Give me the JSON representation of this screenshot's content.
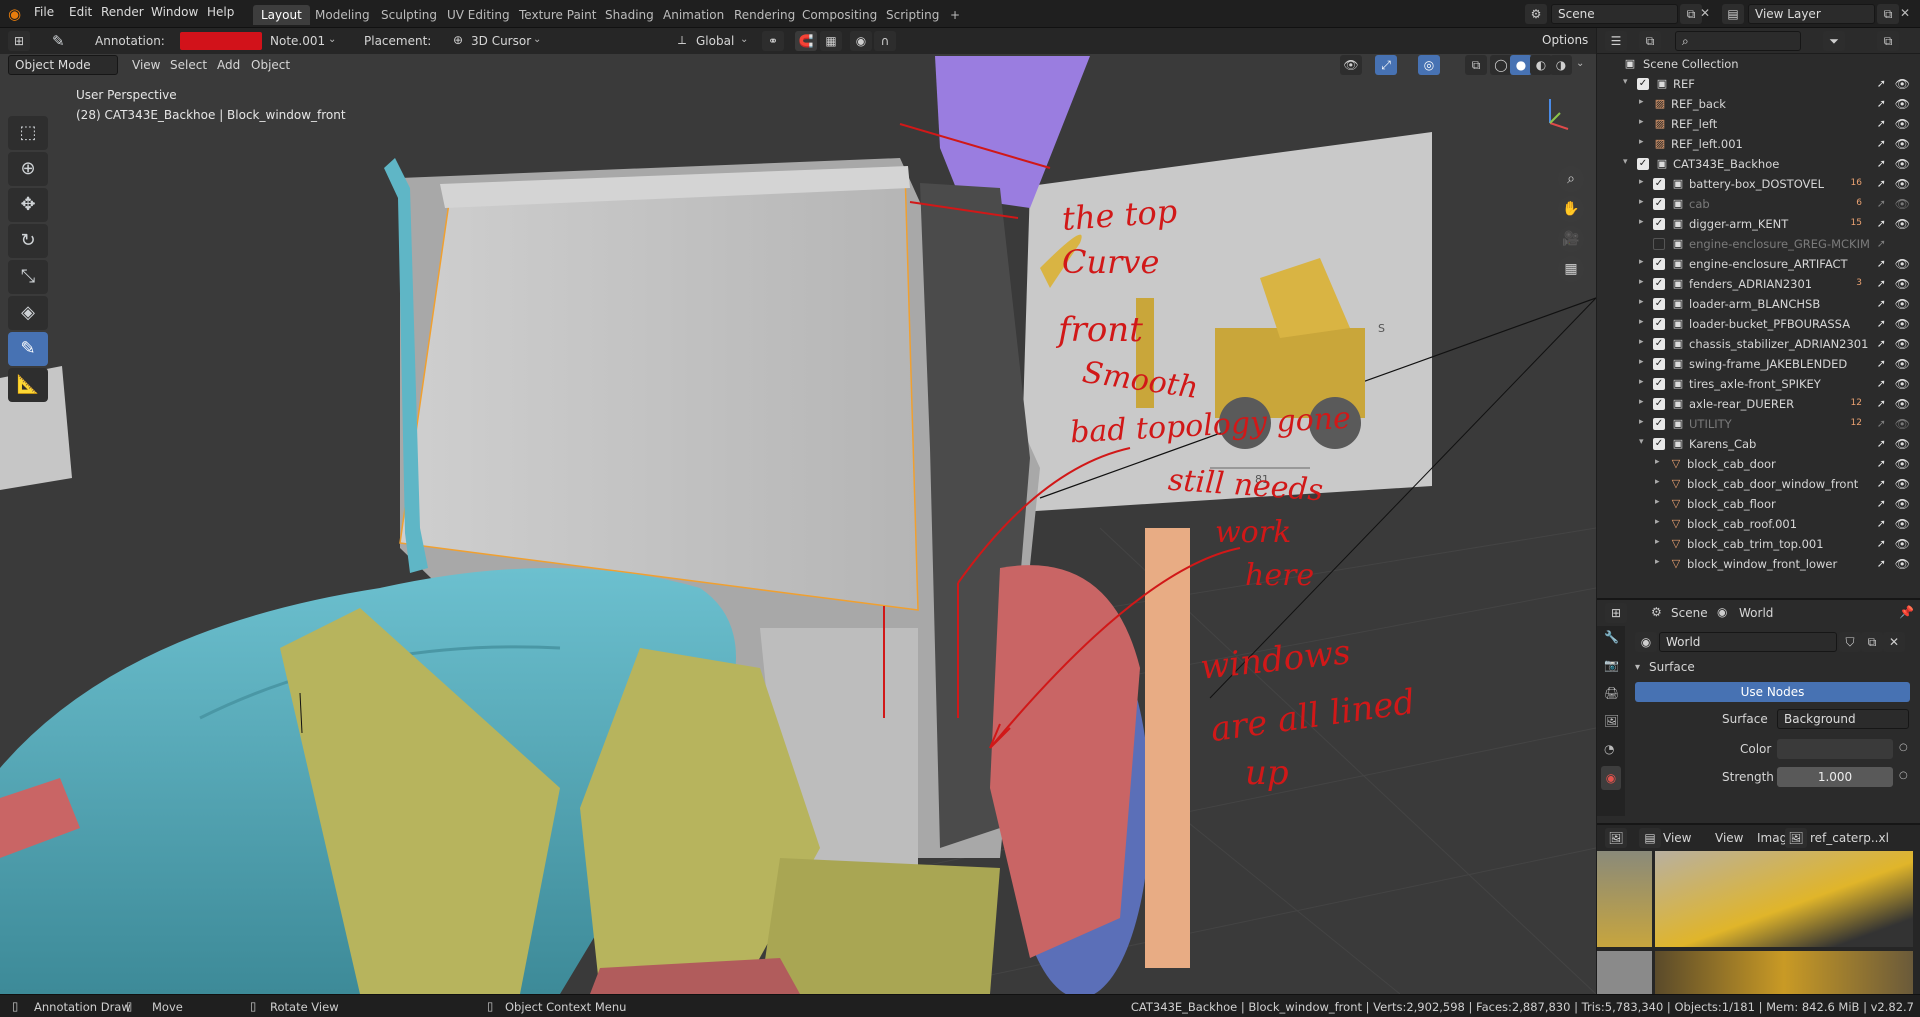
{
  "topbar": {
    "menus": [
      "File",
      "Edit",
      "Render",
      "Window",
      "Help"
    ],
    "workspaces": [
      "Layout",
      "Modeling",
      "Sculpting",
      "UV Editing",
      "Texture Paint",
      "Shading",
      "Animation",
      "Rendering",
      "Compositing",
      "Scripting"
    ],
    "active_workspace": "Layout",
    "add_tab": "+",
    "scene_value": "Scene",
    "view_layer_value": "View Layer"
  },
  "tool_header": {
    "annotation_label": "Annotation:",
    "annotation_color": "#d2121a",
    "note_value": "Note.001",
    "placement_label": "Placement:",
    "placement_value": "3D Cursor",
    "orientation_value": "Global",
    "options_label": "Options"
  },
  "viewport_header": {
    "mode": "Object Mode",
    "menus": [
      "View",
      "Select",
      "Add",
      "Object"
    ]
  },
  "viewport": {
    "perspective_text": "User Perspective",
    "object_info": "(28) CAT343E_Backhoe | Block_window_front"
  },
  "annotations": {
    "line1": "the top",
    "line2": "Curve",
    "line3": "front",
    "line4": "Smooth",
    "line5": "bad topology gone",
    "line6": "still needs",
    "line7": "work",
    "line8": "here",
    "line9": "windows",
    "line10": "are all lined",
    "line11": "up"
  },
  "ref_image": {
    "dimension_label": "81",
    "side_label": "S"
  },
  "outliner": {
    "root": "Scene Collection",
    "rows": [
      {
        "label": "REF",
        "indent": 0,
        "caret": "▾",
        "type": "collection",
        "checked": true,
        "dim": false
      },
      {
        "label": "REF_back",
        "indent": 1,
        "caret": "▸",
        "type": "image",
        "checked": false,
        "dim": false
      },
      {
        "label": "REF_left",
        "indent": 1,
        "caret": "▸",
        "type": "image",
        "checked": false,
        "dim": false
      },
      {
        "label": "REF_left.001",
        "indent": 1,
        "caret": "▸",
        "type": "image",
        "checked": false,
        "dim": false
      },
      {
        "label": "CAT343E_Backhoe",
        "indent": 0,
        "caret": "▾",
        "type": "collection",
        "checked": true,
        "dim": false
      },
      {
        "label": "battery-box_DOSTOVEL",
        "indent": 1,
        "caret": "▸",
        "type": "collection",
        "checked": true,
        "dim": false,
        "badge": "16"
      },
      {
        "label": "cab",
        "indent": 1,
        "caret": "▸",
        "type": "collection",
        "checked": true,
        "dim": true,
        "badge": "6"
      },
      {
        "label": "digger-arm_KENT",
        "indent": 1,
        "caret": "▸",
        "type": "collection",
        "checked": true,
        "dim": false,
        "badge": "15"
      },
      {
        "label": "engine-enclosure_GREG-MCKIM",
        "indent": 1,
        "caret": "",
        "type": "collection",
        "checked": false,
        "dim": true
      },
      {
        "label": "engine-enclosure_ARTIFACT",
        "indent": 1,
        "caret": "▸",
        "type": "collection",
        "checked": true,
        "dim": false
      },
      {
        "label": "fenders_ADRIAN2301",
        "indent": 1,
        "caret": "▸",
        "type": "collection",
        "checked": true,
        "dim": false,
        "badge": "3"
      },
      {
        "label": "loader-arm_BLANCHSB",
        "indent": 1,
        "caret": "▸",
        "type": "collection",
        "checked": true,
        "dim": false
      },
      {
        "label": "loader-bucket_PFBOURASSA",
        "indent": 1,
        "caret": "▸",
        "type": "collection",
        "checked": true,
        "dim": false
      },
      {
        "label": "chassis_stabilizer_ADRIAN2301",
        "indent": 1,
        "caret": "▸",
        "type": "collection",
        "checked": true,
        "dim": false
      },
      {
        "label": "swing-frame_JAKEBLENDED",
        "indent": 1,
        "caret": "▸",
        "type": "collection",
        "checked": true,
        "dim": false
      },
      {
        "label": "tires_axle-front_SPIKEY",
        "indent": 1,
        "caret": "▸",
        "type": "collection",
        "checked": true,
        "dim": false
      },
      {
        "label": "axle-rear_DUERER",
        "indent": 1,
        "caret": "▸",
        "type": "collection",
        "checked": true,
        "dim": false,
        "badge": "12"
      },
      {
        "label": "UTILITY",
        "indent": 1,
        "caret": "▸",
        "type": "collection",
        "checked": true,
        "dim": true,
        "badge": "12"
      },
      {
        "label": "Karens_Cab",
        "indent": 1,
        "caret": "▾",
        "type": "collection",
        "checked": true,
        "dim": false
      },
      {
        "label": "block_cab_door",
        "indent": 2,
        "caret": "▸",
        "type": "mesh",
        "checked": false,
        "dim": false
      },
      {
        "label": "block_cab_door_window_front",
        "indent": 2,
        "caret": "▸",
        "type": "mesh",
        "checked": false,
        "dim": false
      },
      {
        "label": "block_cab_floor",
        "indent": 2,
        "caret": "▸",
        "type": "mesh",
        "checked": false,
        "dim": false
      },
      {
        "label": "block_cab_roof.001",
        "indent": 2,
        "caret": "▸",
        "type": "mesh",
        "checked": false,
        "dim": false
      },
      {
        "label": "block_cab_trim_top.001",
        "indent": 2,
        "caret": "▸",
        "type": "mesh",
        "checked": false,
        "dim": false
      },
      {
        "label": "block_window_front_lower",
        "indent": 2,
        "caret": "▸",
        "type": "mesh",
        "checked": false,
        "dim": false
      }
    ]
  },
  "properties": {
    "breadcrumb_scene": "Scene",
    "breadcrumb_world": "World",
    "world_value": "World",
    "section": "Surface",
    "use_nodes": "Use Nodes",
    "surface_label": "Surface",
    "surface_value": "Background",
    "color_label": "Color",
    "strength_label": "Strength",
    "strength_value": "1.000"
  },
  "image_editor": {
    "view_menu": "View",
    "view2": "View",
    "image_menu": "Image",
    "image_name": "ref_caterp..xl"
  },
  "statusbar": {
    "left1": "Annotation Draw",
    "left2": "Move",
    "left3": "Rotate View",
    "left4": "Object Context Menu",
    "stats": "CAT343E_Backhoe | Block_window_front | Verts:2,902,598 | Faces:2,887,830 | Tris:5,783,340 | Objects:1/181 | Mem: 842.6 MiB | v2.82.7"
  },
  "colors": {
    "accent": "#4772b3",
    "annotation": "#d11818",
    "selection_outline": "#f0a030",
    "cab_gray": "#bdbdbd",
    "hood_teal": "#5fb0bf",
    "loader_olive": "#b7b45d",
    "fender_red": "#c96565",
    "tire_blue": "#5b6fb8",
    "stack_teal": "#5fb6c6",
    "arm_purple": "#9a7de0",
    "stabilizer_tan": "#e8ac84"
  }
}
